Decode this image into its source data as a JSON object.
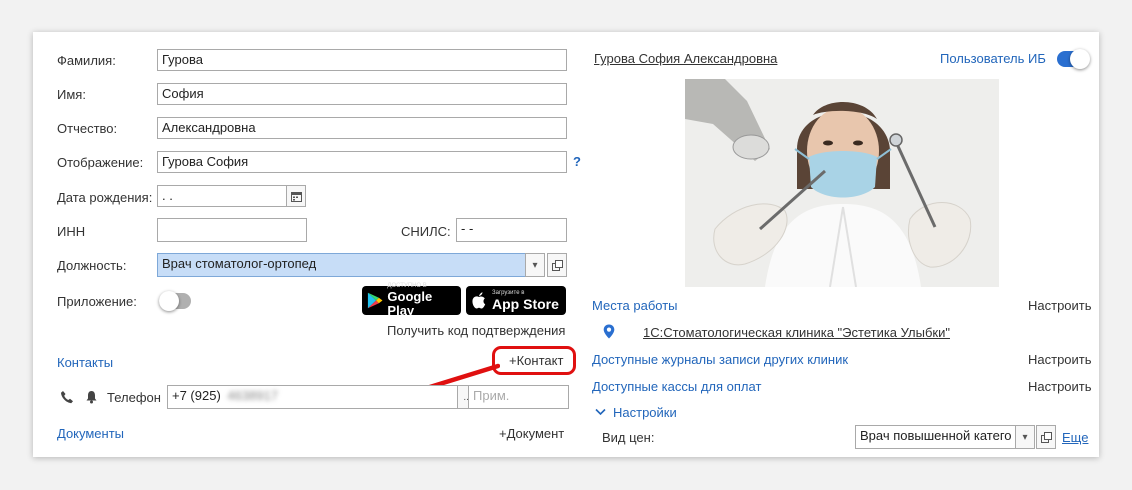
{
  "form": {
    "surname_label": "Фамилия:",
    "surname_value": "Гурова",
    "name_label": "Имя:",
    "name_value": "София",
    "patronymic_label": "Отчество:",
    "patronymic_value": "Александровна",
    "display_label": "Отображение:",
    "display_value": "Гурова София",
    "help_mark": "?",
    "birthdate_label": "Дата рождения:",
    "birthdate_value": " .  .",
    "inn_label": "ИНН",
    "inn_value": "",
    "snils_label": "СНИЛС:",
    "snils_value": "  -   -",
    "position_label": "Должность:",
    "position_value": "Врач стоматолог-ортопед",
    "app_label": "Приложение:",
    "app_toggle_on": false,
    "google_play_small": "ДОСТУПНО В",
    "google_play_big": "Google Play",
    "app_store_small": "Загрузите в",
    "app_store_big": "App Store",
    "get_code_label": "Получить код подтверждения"
  },
  "contacts": {
    "section_label": "Контакты",
    "add_contact_label": "+Контакт",
    "phone_label": "Телефон",
    "phone_value": "+7 (925)",
    "phone_blurred": "4638917",
    "more_button": "...",
    "note_placeholder": "Прим.",
    "highlight_color": "#e01010",
    "arrow_color": "#e01010"
  },
  "documents": {
    "section_label": "Документы",
    "add_document_label": "+Документ"
  },
  "profile": {
    "full_name": "Гурова София Александровна",
    "ib_user_label": "Пользователь ИБ",
    "ib_user_toggle_on": true
  },
  "workplaces": {
    "label": "Места работы",
    "configure": "Настроить",
    "clinic": "1С:Стоматологическая клиника \"Эстетика Улыбки\""
  },
  "journals": {
    "label": "Доступные журналы записи других клиник",
    "configure": "Настроить"
  },
  "cash": {
    "label": "Доступные кассы для оплат",
    "configure": "Настроить"
  },
  "settings": {
    "label": "Настройки",
    "price_type_label": "Вид цен:",
    "price_type_value": "Врач повышенной катего",
    "more_link": "Еще"
  },
  "colors": {
    "link": "#2266bb",
    "accent": "#2a6fd0",
    "selected_field": "#c7ddf7"
  }
}
